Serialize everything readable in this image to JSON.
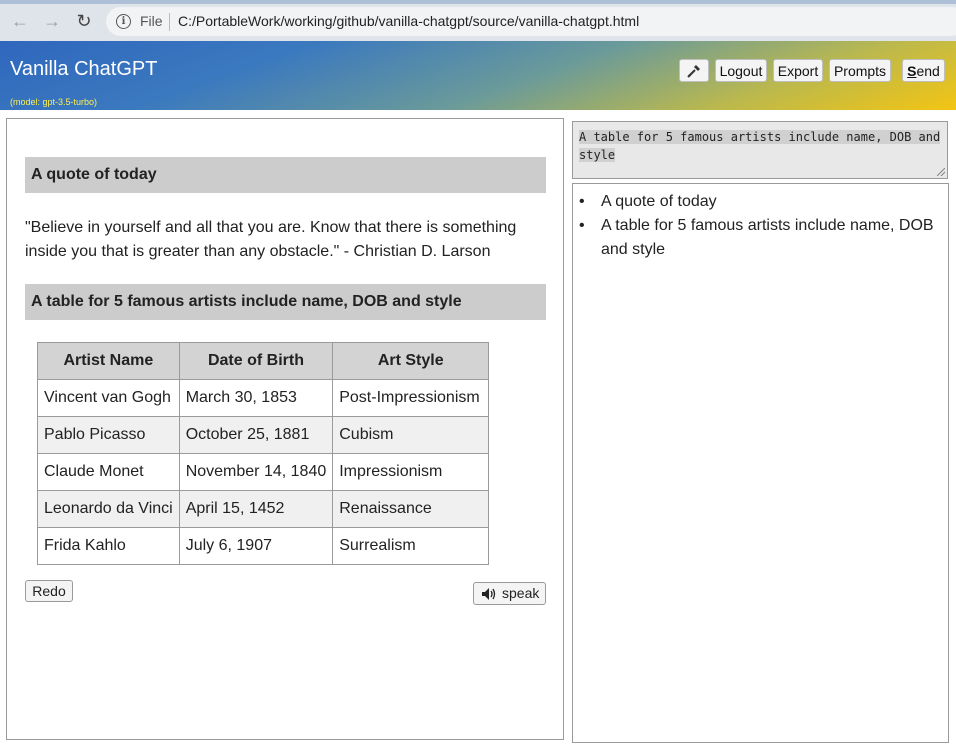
{
  "browser": {
    "file_label": "File",
    "url": "C:/PortableWork/working/github/vanilla-chatgpt/source/vanilla-chatgpt.html",
    "icons": [
      "back-arrow-icon",
      "forward-arrow-icon",
      "reload-icon",
      "info-icon"
    ]
  },
  "header": {
    "title": "Vanilla ChatGPT",
    "model": "(model: gpt-3.5-turbo)",
    "key_icon": "key-icon",
    "logout_label": "Logout",
    "export_label": "Export",
    "prompts_label": "Prompts",
    "send_first": "S",
    "send_rest": "end"
  },
  "conversation": {
    "quote_heading": "A quote of today",
    "quote_text": "\"Believe in yourself and all that you are. Know that there is something inside you that is greater than any obstacle.\" - Christian D. Larson",
    "table_heading": "A table for 5 famous artists include name, DOB and style",
    "table": {
      "headers": [
        "Artist Name",
        "Date of Birth",
        "Art Style"
      ],
      "rows": [
        [
          "Vincent van Gogh",
          "March 30, 1853",
          "Post-Impressionism"
        ],
        [
          "Pablo Picasso",
          "October 25, 1881",
          "Cubism"
        ],
        [
          "Claude Monet",
          "November 14, 1840",
          "Impressionism"
        ],
        [
          "Leonardo da Vinci",
          "April 15, 1452",
          "Renaissance"
        ],
        [
          "Frida Kahlo",
          "July 6, 1907",
          "Surrealism"
        ]
      ]
    },
    "redo_label": "Redo",
    "speak_label": "speak",
    "speak_icon": "speaker-icon"
  },
  "prompt_input": {
    "value": "A table for 5 famous artists include name, DOB and style"
  },
  "history": {
    "items": [
      "A quote of today",
      "A table for 5 famous artists include name, DOB and style"
    ]
  }
}
